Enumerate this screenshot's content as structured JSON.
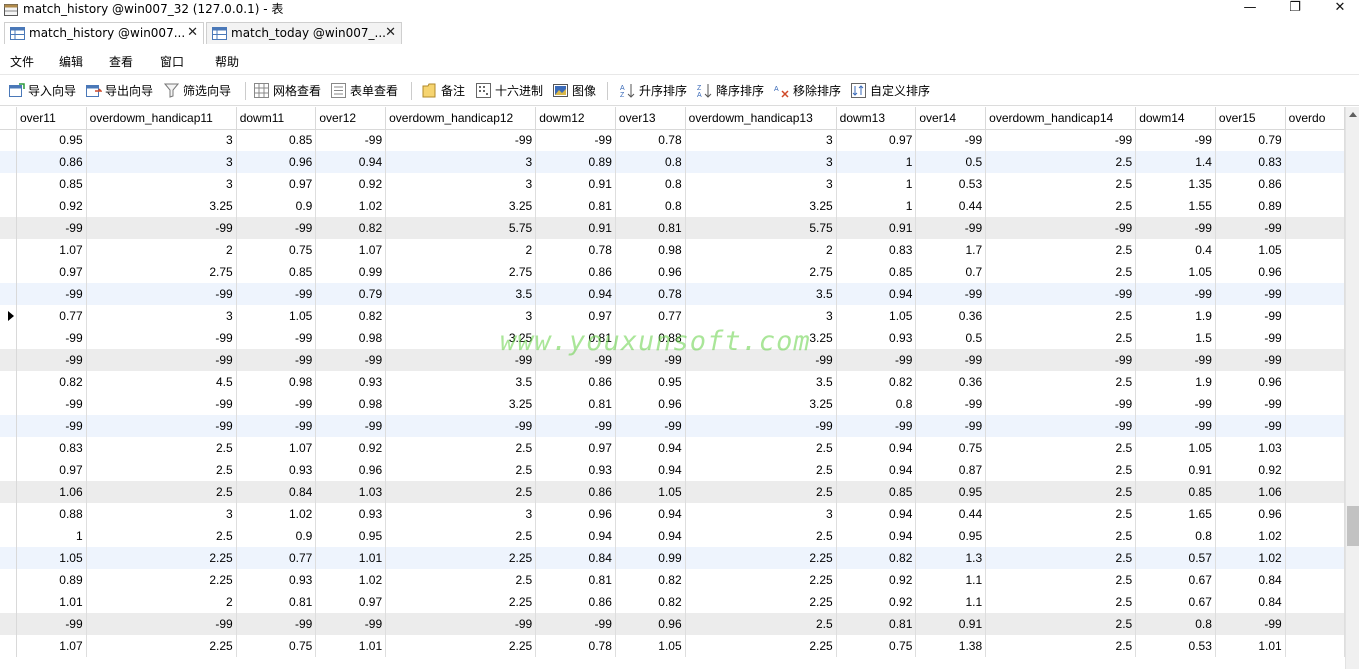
{
  "window": {
    "title": "match_history @win007_32 (127.0.0.1) - 表",
    "minimize": "—",
    "restore": "❐",
    "close": "✕"
  },
  "tabs": [
    {
      "label": "match_history @win007...",
      "close": "✕"
    },
    {
      "label": "match_today @win007_...",
      "close": "✕"
    }
  ],
  "menu": {
    "file": "文件",
    "edit": "编辑",
    "view": "查看",
    "window": "窗口",
    "help": "帮助"
  },
  "toolbar": {
    "import_wizard": "导入向导",
    "export_wizard": "导出向导",
    "filter_wizard": "筛选向导",
    "grid_view": "网格查看",
    "form_view": "表单查看",
    "memo": "备注",
    "hex": "十六进制",
    "image": "图像",
    "sort_asc": "升序排序",
    "sort_desc": "降序排序",
    "remove_sort": "移除排序",
    "custom_sort": "自定义排序"
  },
  "grid": {
    "columns": [
      "over11",
      "overdowm_handicap11",
      "dowm11",
      "over12",
      "overdowm_handicap12",
      "dowm12",
      "over13",
      "overdowm_handicap13",
      "dowm13",
      "over14",
      "overdowm_handicap14",
      "dowm14",
      "over15",
      "overdo"
    ],
    "current_row_index": 8,
    "rows": [
      [
        "0.95",
        "3",
        "0.85",
        "-99",
        "-99",
        "-99",
        "0.78",
        "3",
        "0.97",
        "-99",
        "-99",
        "-99",
        "0.79",
        ""
      ],
      [
        "0.86",
        "3",
        "0.96",
        "0.94",
        "3",
        "0.89",
        "0.8",
        "3",
        "1",
        "0.5",
        "2.5",
        "1.4",
        "0.83",
        ""
      ],
      [
        "0.85",
        "3",
        "0.97",
        "0.92",
        "3",
        "0.91",
        "0.8",
        "3",
        "1",
        "0.53",
        "2.5",
        "1.35",
        "0.86",
        ""
      ],
      [
        "0.92",
        "3.25",
        "0.9",
        "1.02",
        "3.25",
        "0.81",
        "0.8",
        "3.25",
        "1",
        "0.44",
        "2.5",
        "1.55",
        "0.89",
        ""
      ],
      [
        "-99",
        "-99",
        "-99",
        "0.82",
        "5.75",
        "0.91",
        "0.81",
        "5.75",
        "0.91",
        "-99",
        "-99",
        "-99",
        "-99",
        ""
      ],
      [
        "1.07",
        "2",
        "0.75",
        "1.07",
        "2",
        "0.78",
        "0.98",
        "2",
        "0.83",
        "1.7",
        "2.5",
        "0.4",
        "1.05",
        ""
      ],
      [
        "0.97",
        "2.75",
        "0.85",
        "0.99",
        "2.75",
        "0.86",
        "0.96",
        "2.75",
        "0.85",
        "0.7",
        "2.5",
        "1.05",
        "0.96",
        ""
      ],
      [
        "-99",
        "-99",
        "-99",
        "0.79",
        "3.5",
        "0.94",
        "0.78",
        "3.5",
        "0.94",
        "-99",
        "-99",
        "-99",
        "-99",
        ""
      ],
      [
        "0.77",
        "3",
        "1.05",
        "0.82",
        "3",
        "0.97",
        "0.77",
        "3",
        "1.05",
        "0.36",
        "2.5",
        "1.9",
        "-99",
        ""
      ],
      [
        "-99",
        "-99",
        "-99",
        "0.98",
        "3.25",
        "0.81",
        "0.88",
        "3.25",
        "0.93",
        "0.5",
        "2.5",
        "1.5",
        "-99",
        ""
      ],
      [
        "-99",
        "-99",
        "-99",
        "-99",
        "-99",
        "-99",
        "-99",
        "-99",
        "-99",
        "-99",
        "-99",
        "-99",
        "-99",
        ""
      ],
      [
        "0.82",
        "4.5",
        "0.98",
        "0.93",
        "3.5",
        "0.86",
        "0.95",
        "3.5",
        "0.82",
        "0.36",
        "2.5",
        "1.9",
        "0.96",
        ""
      ],
      [
        "-99",
        "-99",
        "-99",
        "0.98",
        "3.25",
        "0.81",
        "0.96",
        "3.25",
        "0.8",
        "-99",
        "-99",
        "-99",
        "-99",
        ""
      ],
      [
        "-99",
        "-99",
        "-99",
        "-99",
        "-99",
        "-99",
        "-99",
        "-99",
        "-99",
        "-99",
        "-99",
        "-99",
        "-99",
        ""
      ],
      [
        "0.83",
        "2.5",
        "1.07",
        "0.92",
        "2.5",
        "0.97",
        "0.94",
        "2.5",
        "0.94",
        "0.75",
        "2.5",
        "1.05",
        "1.03",
        ""
      ],
      [
        "0.97",
        "2.5",
        "0.93",
        "0.96",
        "2.5",
        "0.93",
        "0.94",
        "2.5",
        "0.94",
        "0.87",
        "2.5",
        "0.91",
        "0.92",
        ""
      ],
      [
        "1.06",
        "2.5",
        "0.84",
        "1.03",
        "2.5",
        "0.86",
        "1.05",
        "2.5",
        "0.85",
        "0.95",
        "2.5",
        "0.85",
        "1.06",
        ""
      ],
      [
        "0.88",
        "3",
        "1.02",
        "0.93",
        "3",
        "0.96",
        "0.94",
        "3",
        "0.94",
        "0.44",
        "2.5",
        "1.65",
        "0.96",
        ""
      ],
      [
        "1",
        "2.5",
        "0.9",
        "0.95",
        "2.5",
        "0.94",
        "0.94",
        "2.5",
        "0.94",
        "0.95",
        "2.5",
        "0.8",
        "1.02",
        ""
      ],
      [
        "1.05",
        "2.25",
        "0.77",
        "1.01",
        "2.25",
        "0.84",
        "0.99",
        "2.25",
        "0.82",
        "1.3",
        "2.5",
        "0.57",
        "1.02",
        ""
      ],
      [
        "0.89",
        "2.25",
        "0.93",
        "1.02",
        "2.5",
        "0.81",
        "0.82",
        "2.25",
        "0.92",
        "1.1",
        "2.5",
        "0.67",
        "0.84",
        ""
      ],
      [
        "1.01",
        "2",
        "0.81",
        "0.97",
        "2.25",
        "0.86",
        "0.82",
        "2.25",
        "0.92",
        "1.1",
        "2.5",
        "0.67",
        "0.84",
        ""
      ],
      [
        "-99",
        "-99",
        "-99",
        "-99",
        "-99",
        "-99",
        "0.96",
        "2.5",
        "0.81",
        "0.91",
        "2.5",
        "0.8",
        "-99",
        ""
      ],
      [
        "1.07",
        "2.25",
        "0.75",
        "1.01",
        "2.25",
        "0.78",
        "1.05",
        "2.25",
        "0.75",
        "1.38",
        "2.5",
        "0.53",
        "1.01",
        ""
      ]
    ],
    "row_styles": [
      "white",
      "blue",
      "white",
      "white",
      "gray",
      "white",
      "white",
      "blue",
      "white",
      "white",
      "gray",
      "white",
      "white",
      "blue",
      "white",
      "white",
      "gray",
      "white",
      "white",
      "blue",
      "white",
      "white",
      "gray",
      "white"
    ]
  },
  "watermark": "www.youxunsoft.com",
  "colors": {
    "row_gray": "#ececec",
    "row_blue": "#eef4fd",
    "watermark": "#64d246"
  }
}
